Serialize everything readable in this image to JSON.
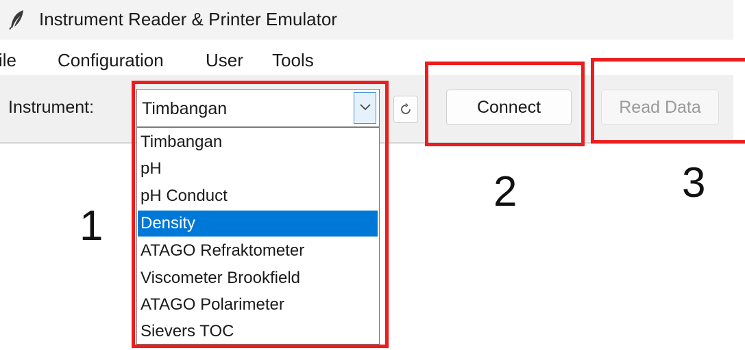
{
  "window": {
    "title": "Instrument Reader & Printer Emulator",
    "icon": "feather-icon"
  },
  "menu": {
    "items": [
      {
        "label": "File",
        "visible_text": "ile"
      },
      {
        "label": "Configuration"
      },
      {
        "label": "User"
      },
      {
        "label": "Tools"
      }
    ]
  },
  "toolbar": {
    "instrument_label": "Instrument:",
    "instrument_combo": {
      "selected_value": "Timbangan",
      "arrow_icon": "chevron-down-icon",
      "options": [
        "Timbangan",
        "pH",
        "pH Conduct",
        "Density",
        "ATAGO Refraktometer",
        "Viscometer Brookfield",
        "ATAGO Polarimeter",
        "Sievers TOC"
      ],
      "highlighted_option": "Density"
    },
    "refresh_icon": "refresh-icon",
    "connect_label": "Connect",
    "read_data_label": "Read Data",
    "read_data_enabled": false
  },
  "annotations": {
    "highlight_color": "#ee1c1c",
    "step1": "1",
    "step2": "2",
    "step3": "3"
  },
  "colors": {
    "selection": "#0078d7",
    "toolbar_bg": "#f0f0f0",
    "titlebar_bg": "#f3f3f3"
  }
}
